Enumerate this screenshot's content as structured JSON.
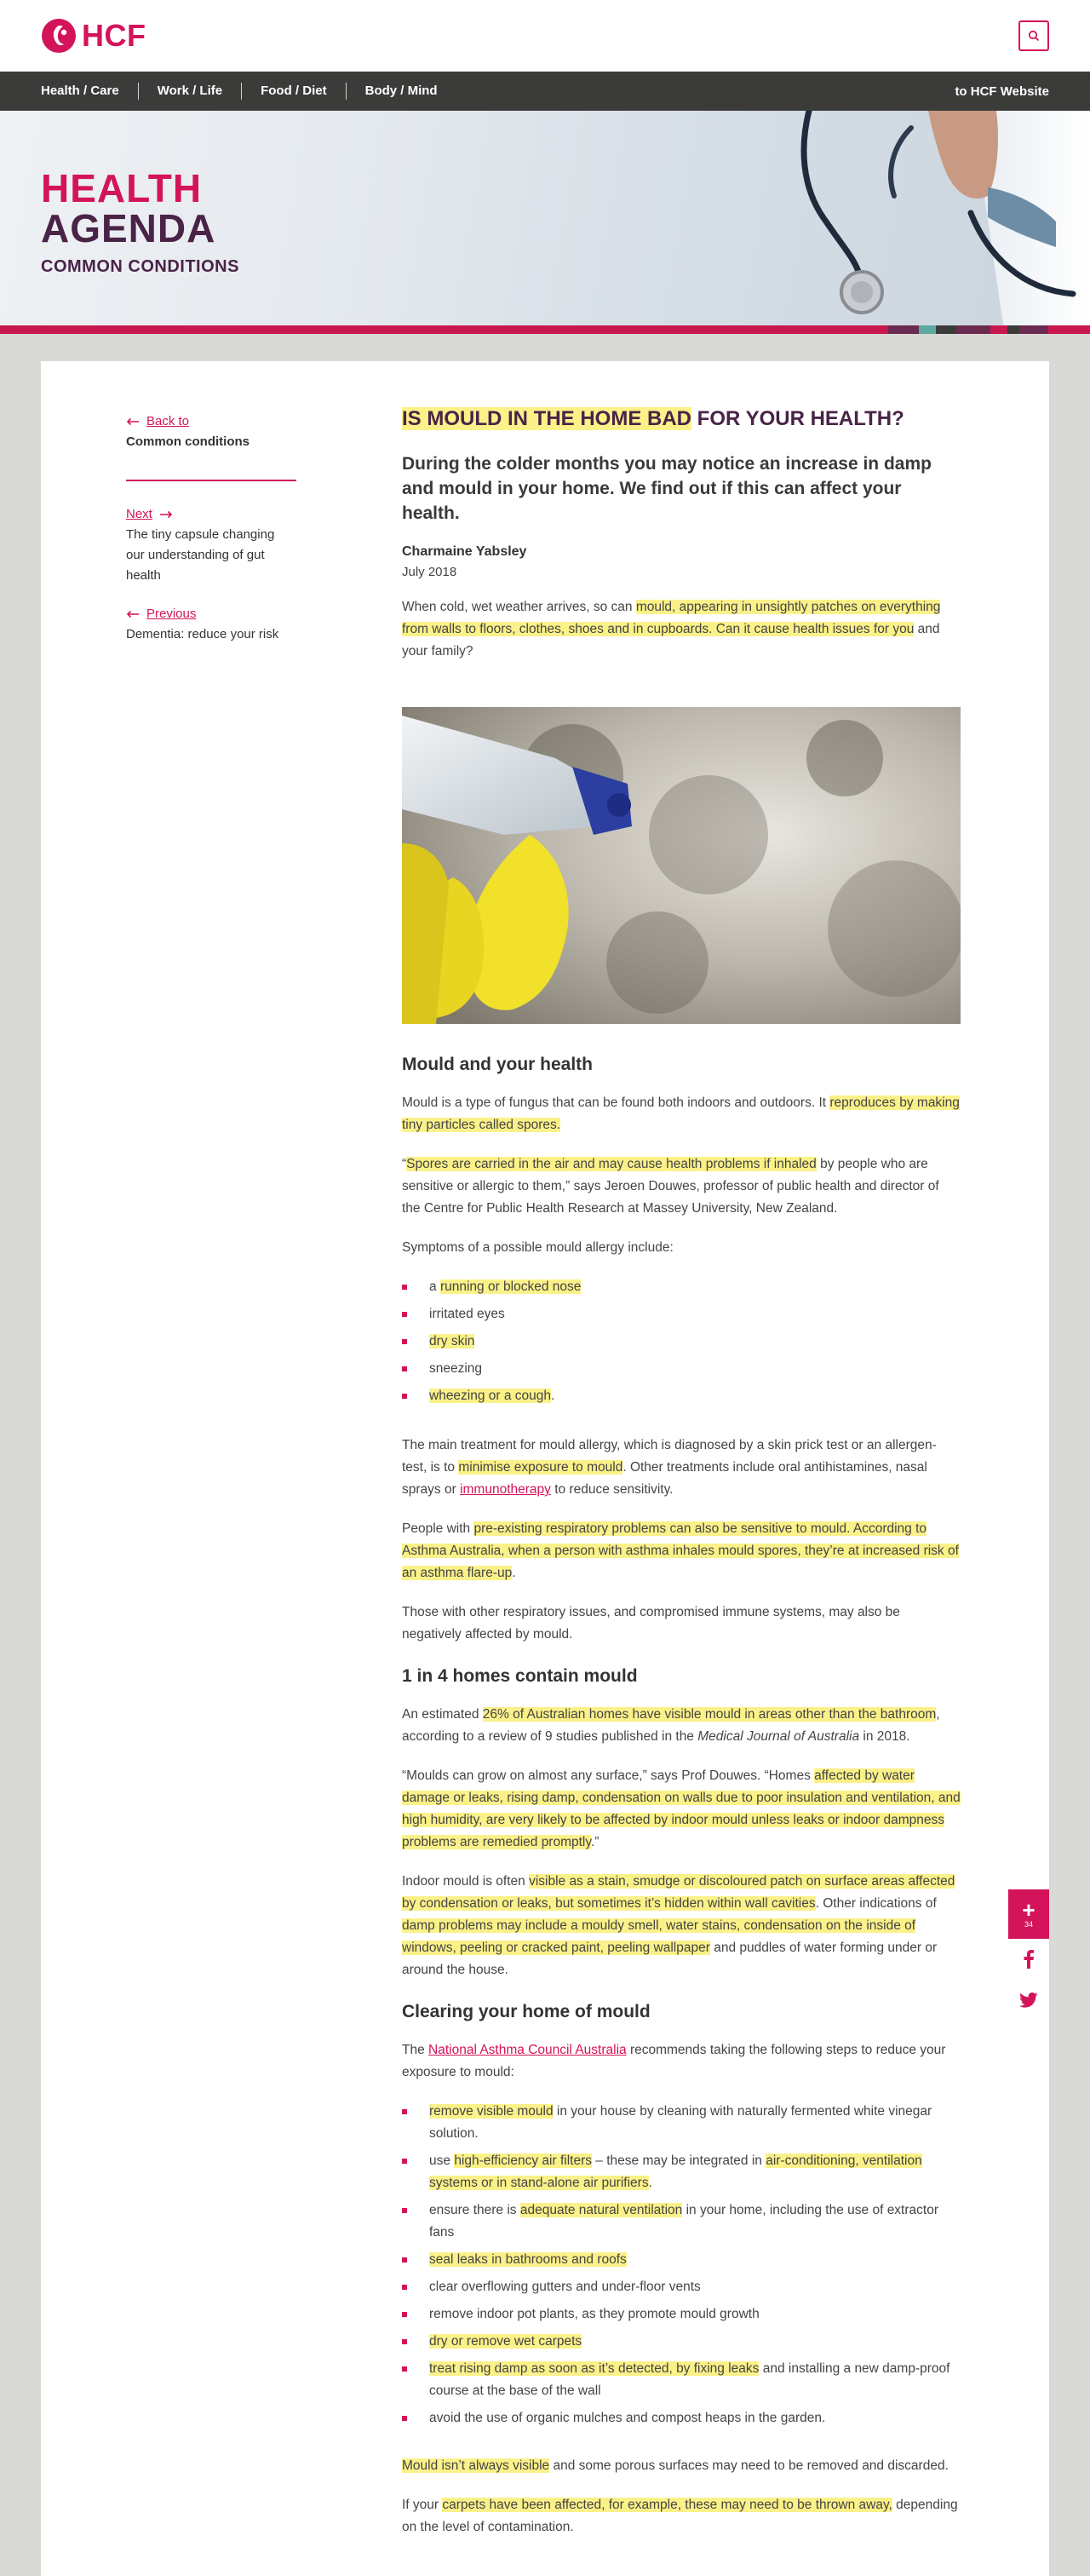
{
  "brand": {
    "name": "HCF",
    "accent": "#d4145a",
    "plum": "#4a2347"
  },
  "nav": {
    "items": [
      "Health / Care",
      "Work / Life",
      "Food / Diet",
      "Body / Mind"
    ],
    "external": "to HCF Website"
  },
  "hero": {
    "line1": "HEALTH",
    "line2": "AGENDA",
    "section": "COMMON CONDITIONS"
  },
  "sidebar": {
    "back_label": "Back to",
    "back_title": "Common conditions",
    "next_label": "Next",
    "next_title": "The tiny capsule changing our understanding of gut health",
    "prev_label": "Previous",
    "prev_title": "Dementia: reduce your risk"
  },
  "article": {
    "title_hl": "IS MOULD IN THE HOME BAD",
    "title_rest": " FOR YOUR HEALTH?",
    "standfirst": "During the colder months you may notice an increase in damp and mould in your home. We find out if this can affect your health.",
    "author": "Charmaine Yabsley",
    "date": "July 2018",
    "intro_a": "When cold, wet weather arrives, so can ",
    "intro_hl": "mould, appearing in unsightly patches on everything from walls to floors, clothes, shoes and in cupboards. Can it cause health issues for you",
    "intro_b": " and your family?",
    "s1_heading": "Mould and your health",
    "p1_a": "Mould is a type of fungus that can be found both indoors and outdoors. It ",
    "p1_hl": "reproduces by making tiny particles called spores.",
    "p2_a": "“",
    "p2_hl": "Spores are carried in the air and may cause health problems if inhaled",
    "p2_b": " by people who are sensitive or allergic to them,” says Jeroen Douwes, professor of public health and director of the Centre for Public Health Research at Massey University, New Zealand.",
    "p3": "Symptoms of a possible mould allergy include:",
    "sym1_a": "a ",
    "sym1_hl": "running or blocked nose",
    "sym2": "irritated eyes",
    "sym3_hl": "dry skin",
    "sym4": "sneezing",
    "sym5_hl": "wheezing or a cough",
    "sym5_b": ".",
    "p4_a": "The main treatment for mould allergy, which is diagnosed by a skin prick test or an allergen- test, is to ",
    "p4_hl": "minimise exposure to mould",
    "p4_b": ". Other treatments include oral antihistamines, nasal sprays or ",
    "p4_link": "immunotherapy",
    "p4_c": " to reduce sensitivity.",
    "p5_a": "People with ",
    "p5_hl": "pre-existing respiratory problems can also be sensitive to mould. According to Asthma Australia, when a person with asthma inhales mould spores, they’re at increased risk of an asthma flare-up",
    "p5_b": ".",
    "p6": "Those with other respiratory issues, and compromised immune systems, may also be negatively affected by mould.",
    "s2_heading": "1 in 4 homes contain mould",
    "p7_a": "An estimated ",
    "p7_hl": "26% of Australian homes have visible mould in areas other than the bathroom",
    "p7_b": ", according to a review of 9 studies published in the ",
    "p7_i": "Medical Journal of Australia",
    "p7_c": " in 2018.",
    "p8_a": "“Moulds can grow on almost any surface,” says Prof Douwes. “Homes ",
    "p8_hl": "affected by water damage or leaks, rising damp, condensation on walls due to poor insulation and ventilation, and high humidity, are very likely to be affected by indoor mould unless leaks or indoor dampness problems are remedied promptly",
    "p8_b": ".”",
    "p9_a": "Indoor mould is often ",
    "p9_hl1": "visible as a stain, smudge or discoloured patch on surface areas affected by condensation or leaks, but sometimes it’s hidden within wall cavities",
    "p9_b": ". Other indications of ",
    "p9_hl2": "damp problems may include a mouldy smell, water stains, condensation on the inside of windows, peeling or cracked paint, peeling wallpaper",
    "p9_c": " and puddles of water forming under or around the house.",
    "s3_heading": "Clearing your home of mould",
    "p10_a": "The ",
    "p10_link": "National Asthma Council Australia",
    "p10_b": " recommends taking the following steps to reduce your exposure to mould:",
    "st1_hl": "remove visible mould",
    "st1_b": " in your house by cleaning with naturally fermented white vinegar solution.",
    "st2_a": "use ",
    "st2_hl1": "high-efficiency air filters",
    "st2_b": " – these may be integrated in ",
    "st2_hl2": "air-conditioning, ventilation systems or in stand-alone air purifiers",
    "st2_c": ".",
    "st3_a": "ensure there is ",
    "st3_hl": "adequate natural ventilation",
    "st3_b": " in your home, including the use of extractor fans",
    "st4_hl": "seal leaks in bathrooms and roofs",
    "st5": "clear overflowing gutters and under-floor vents",
    "st6": "remove indoor pot plants, as they promote mould growth",
    "st7_hl": "dry or remove wet carpets",
    "st8_hl": "treat rising damp as soon as it’s detected, by fixing leaks",
    "st8_b": " and installing a new damp-proof course at the base of the wall",
    "st9": "avoid the use of organic mulches and compost heaps in the garden.",
    "p11_hl": "Mould isn’t always visible",
    "p11_b": " and some porous surfaces may need to be removed and discarded.",
    "p12_a": "If your ",
    "p12_hl": "carpets have been affected, for example, these may need to be thrown away,",
    "p12_b": " depending on the level of contamination."
  },
  "share": {
    "count": "34",
    "icons": [
      "plus-icon",
      "facebook-icon",
      "twitter-icon"
    ]
  }
}
